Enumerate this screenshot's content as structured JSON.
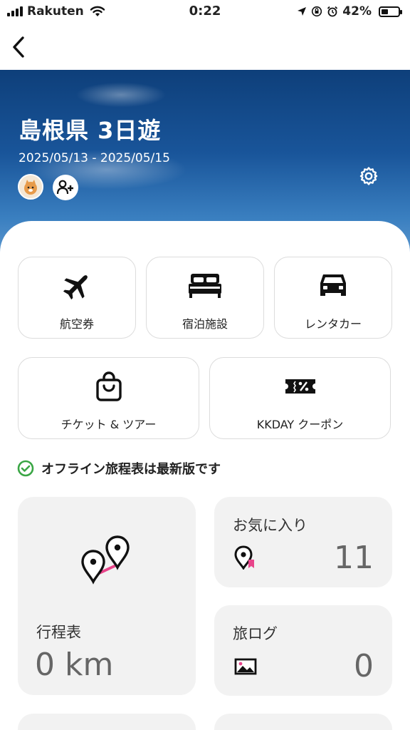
{
  "status_bar": {
    "carrier": "Rakuten",
    "time": "0:22",
    "battery": "42%",
    "battery_level": 0.42
  },
  "trip": {
    "title": "島根県 3日遊",
    "dates": "2025/05/13 - 2025/05/15"
  },
  "services": [
    {
      "label": "航空券",
      "icon": "airplane-icon"
    },
    {
      "label": "宿泊施設",
      "icon": "bed-icon"
    },
    {
      "label": "レンタカー",
      "icon": "car-icon"
    },
    {
      "label": "チケット & ツアー",
      "icon": "shopping-bag-icon"
    },
    {
      "label": "KKDAY クーポン",
      "icon": "coupon-ticket-icon"
    }
  ],
  "offline_status": "オフライン旅程表は最新版です",
  "cards": {
    "itinerary": {
      "title": "行程表",
      "value": "0 km",
      "icon": "route-pins-icon"
    },
    "favorites": {
      "title": "お気に入り",
      "value": "11",
      "icon": "pin-bookmark-icon"
    },
    "travel_log": {
      "title": "旅ログ",
      "value": "0",
      "icon": "photo-icon"
    }
  },
  "colors": {
    "accent_pink": "#e8458b",
    "check_green": "#3aa645",
    "card_bg": "#f2f2f2",
    "hero_sky": "#19559a"
  }
}
